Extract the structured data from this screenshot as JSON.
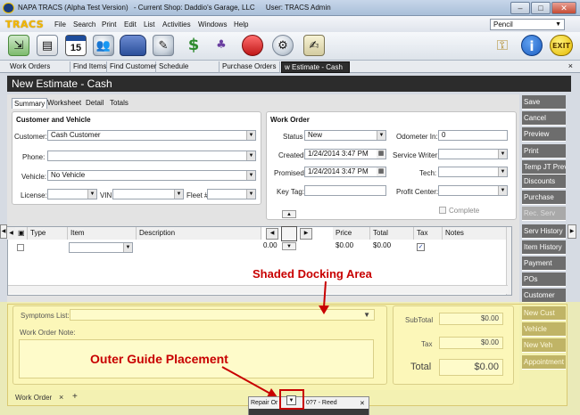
{
  "window": {
    "title_parts": [
      "NAPA TRACS (Alpha Test Version)",
      "- Current Shop: Daddio's Garage, LLC",
      "User: TRACS Admin"
    ],
    "minimize": "–",
    "maximize": "□",
    "close": "✕"
  },
  "menubar": {
    "logo": "TRACS",
    "items": [
      "File",
      "Search",
      "Print",
      "Edit",
      "List",
      "Activities",
      "Windows",
      "Help"
    ],
    "pencil_select": "Pencil"
  },
  "toolbar": {
    "icons": [
      "import-icon",
      "document-icon",
      "calendar-icon",
      "customers-icon",
      "vehicle-icon",
      "tech-icon",
      "money-icon",
      "parts-icon",
      "sale-icon",
      "tools-icon",
      "notes-icon"
    ],
    "calendar_day": "15",
    "right_icons": [
      "keys-icon",
      "info-icon",
      "exit-icon"
    ],
    "exit_label": "EXIT",
    "info_label": "i"
  },
  "tabs": {
    "items": [
      "Work Orders",
      "Find Items",
      "Find Customer",
      "Schedule",
      "Purchase Orders",
      "w Estimate - Cash"
    ],
    "close": "×"
  },
  "header": {
    "title": "New Estimate - Cash"
  },
  "subtabs": [
    "Summary",
    "Worksheet",
    "Detail",
    "Totals"
  ],
  "customer_vehicle": {
    "title": "Customer and Vehicle",
    "customer_label": "Customer:",
    "customer_value": "Cash Customer",
    "phone_label": "Phone:",
    "phone_value": "",
    "vehicle_label": "Vehicle:",
    "vehicle_value": "No Vehicle",
    "license_label": "License:",
    "vin_label": "VIN",
    "fleet_label": "Fleet #"
  },
  "work_order": {
    "title": "Work Order",
    "status_label": "Status",
    "status_value": "New",
    "created_label": "Created",
    "created_value": "1/24/2014 3:47 PM",
    "promised_label": "Promised",
    "promised_value": "1/24/2014 3:47 PM",
    "keytag_label": "Key Tag:",
    "odometer_label": "Odometer In:",
    "odometer_value": "0",
    "service_writer_label": "Service Writer:",
    "tech_label": "Tech:",
    "profit_center_label": "Profit Center:",
    "complete_label": "Complete"
  },
  "grid": {
    "headers": [
      "Type",
      "Item",
      "Description",
      "Price",
      "Total",
      "Tax",
      "Notes"
    ],
    "row": {
      "qty": "0.00",
      "price": "$0.00",
      "total": "$0.00",
      "tax": "✓"
    }
  },
  "side_buttons": [
    {
      "label": "Save",
      "state": "dark"
    },
    {
      "label": "Cancel",
      "state": "dark"
    },
    {
      "label": "Preview",
      "state": "dark"
    },
    {
      "label": "Print",
      "state": "dark"
    },
    {
      "label": "Temp JT Prev",
      "state": "dark"
    },
    {
      "label": "Discounts",
      "state": "dark"
    },
    {
      "label": "Purchase",
      "state": "dark"
    },
    {
      "label": "Rec. Serv",
      "state": "dim"
    },
    {
      "label": "Serv History",
      "state": "dark"
    },
    {
      "label": "Item History",
      "state": "dark"
    },
    {
      "label": "Payment",
      "state": "dark"
    },
    {
      "label": "POs",
      "state": "dark"
    },
    {
      "label": "Customer",
      "state": "dark"
    },
    {
      "label": "New Cust",
      "state": "dark"
    },
    {
      "label": "Vehicle",
      "state": "dark"
    },
    {
      "label": "New Veh",
      "state": "dark"
    },
    {
      "label": "Appointment",
      "state": "dark"
    }
  ],
  "dock": {
    "symptoms_label": "Symptoms List:",
    "note_label": "Work Order Note:",
    "subtotal_label": "SubTotal",
    "subtotal_value": "$0.00",
    "tax_label": "Tax",
    "tax_value": "$0.00",
    "total_label": "Total",
    "total_value": "$0.00"
  },
  "annotations": {
    "docking": "Shaded Docking Area",
    "outer_guide": "Outer Guide Placement"
  },
  "bottom_tabs": {
    "work_order": "Work Order",
    "close": "×",
    "add": "+"
  },
  "guide_popup": {
    "left_text": "Repair Or",
    "right_text": "0?7 - Reed"
  },
  "colors": {
    "accent_red": "#c80000",
    "dock_yellow": "#fcf696",
    "side_button": "#6d6d6d"
  }
}
